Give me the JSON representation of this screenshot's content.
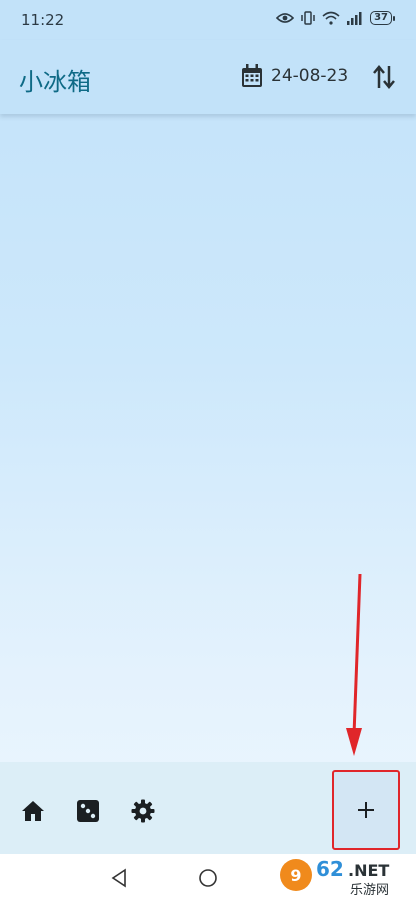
{
  "status_bar": {
    "time": "11:22",
    "battery": "37"
  },
  "app_bar": {
    "title": "小冰箱",
    "date": "24-08-23"
  },
  "icons": {
    "calendar": "calendar-icon",
    "sort": "sort-arrows-icon",
    "home": "home-icon",
    "dice": "dice-icon",
    "settings": "gear-icon",
    "add": "plus-icon"
  },
  "fab": {
    "label": "+"
  },
  "colors": {
    "title": "#0e6a86",
    "app_bar_bg": "#c2e2f9",
    "bottom_bar_bg": "#dceef7",
    "highlight_box": "#e0262a"
  },
  "watermark": {
    "brand": "962.NET",
    "subtitle": "乐游网"
  }
}
